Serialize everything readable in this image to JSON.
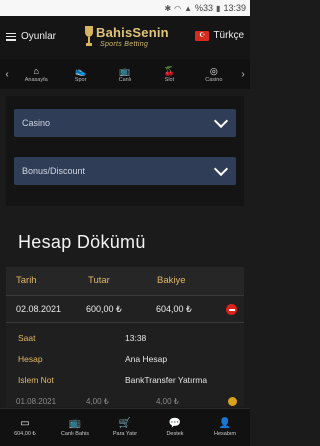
{
  "status_bar": {
    "battery": "%33",
    "time": "13:39"
  },
  "header": {
    "menu_label": "Oyunlar",
    "logo_title": "BahisSenin",
    "logo_subtitle": "Sports Betting",
    "language_label": "Türkçe",
    "flag_glyph": "☪"
  },
  "nav": {
    "prev_glyph": "‹",
    "next_glyph": "›",
    "items": [
      {
        "label": "Anasayfa",
        "icon": "home-icon",
        "glyph": "⌂"
      },
      {
        "label": "Spor",
        "icon": "shoe-icon",
        "glyph": "👟"
      },
      {
        "label": "Canlı",
        "icon": "tv-icon",
        "glyph": "📺"
      },
      {
        "label": "Slot",
        "icon": "cherries-icon",
        "glyph": "🍒"
      },
      {
        "label": "Casino",
        "icon": "chip-icon",
        "glyph": "◎"
      }
    ]
  },
  "filters": {
    "casino_label": "Casino",
    "bonus_label": "Bonus/Discount"
  },
  "page_title": "Hesap Dökümü",
  "table": {
    "headers": {
      "date": "Tarih",
      "amount": "Tutar",
      "balance": "Bakiye"
    },
    "row": {
      "date": "02.08.2021",
      "amount": "600,00 ₺",
      "balance": "604,00 ₺"
    },
    "details": [
      {
        "label": "Saat",
        "value": "13:38"
      },
      {
        "label": "Hesap",
        "value": "Ana Hesap"
      },
      {
        "label": "Islem Not",
        "value": "BankTransfer Yatırma"
      }
    ],
    "peek_row": {
      "date": "01.08.2021",
      "amount": "4,00 ₺",
      "balance": "4,00 ₺"
    }
  },
  "bottom_bar": {
    "items": [
      {
        "label": "604,00 ₺",
        "icon": "wallet-icon",
        "glyph": "▭"
      },
      {
        "label": "Canlı Bahis",
        "icon": "tv-icon",
        "glyph": "📺"
      },
      {
        "label": "Para Yatır",
        "icon": "cart-icon",
        "glyph": "🛒"
      },
      {
        "label": "Destek",
        "icon": "chat-icon",
        "glyph": "💬"
      },
      {
        "label": "Hesabım",
        "icon": "user-icon",
        "glyph": "👤"
      }
    ]
  },
  "colors": {
    "accent": "#e0b764",
    "select_bg": "#2f3d56",
    "danger": "#d9231b",
    "background": "#1b1b1b"
  }
}
